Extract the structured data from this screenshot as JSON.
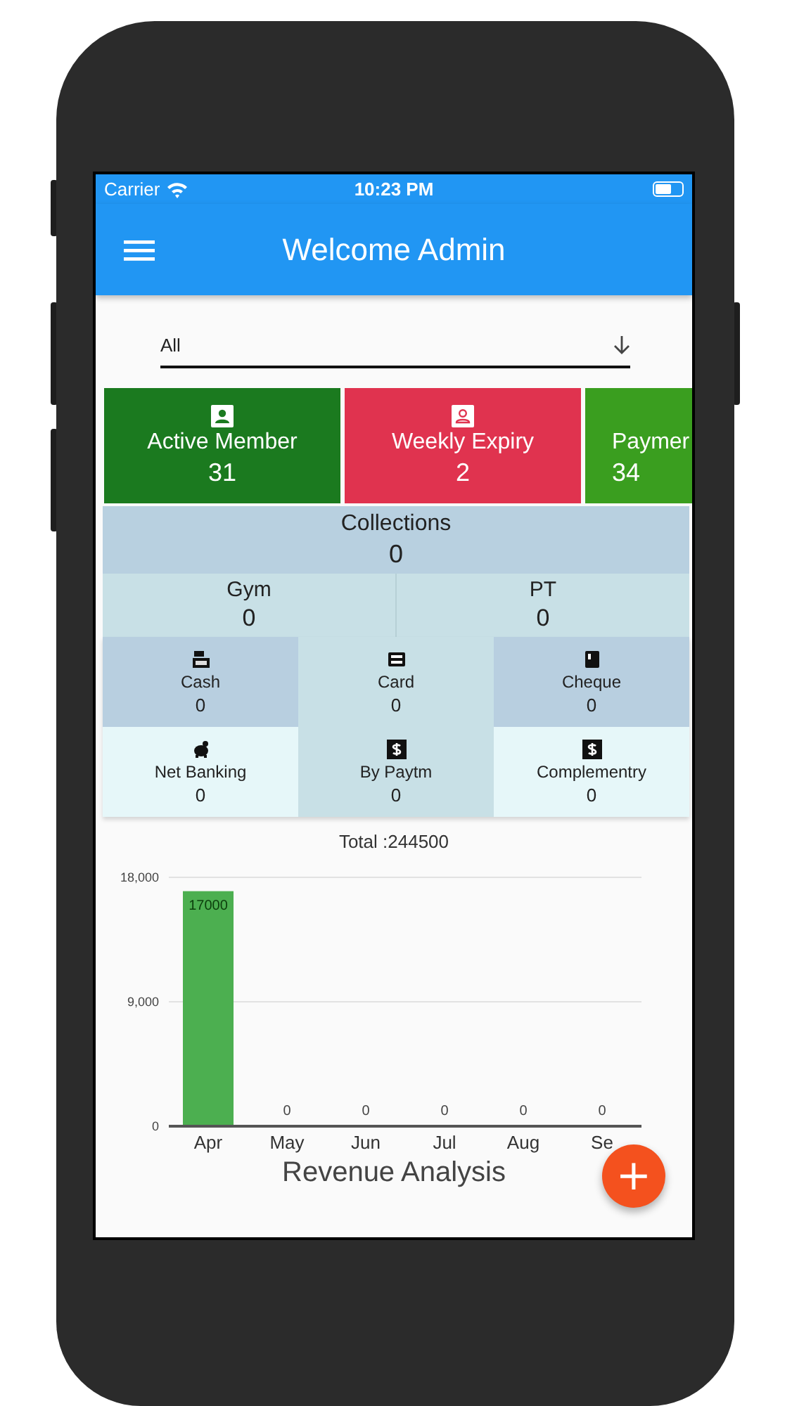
{
  "status_bar": {
    "carrier": "Carrier",
    "time": "10:23 PM"
  },
  "app_bar": {
    "title": "Welcome Admin"
  },
  "filter": {
    "value": "All"
  },
  "tiles": [
    {
      "label": "Active Member",
      "value": "31",
      "color": "#1b7a1f",
      "kind": "person"
    },
    {
      "label": "Weekly Expiry",
      "value": "2",
      "color": "#e0334f",
      "kind": "person-outline"
    },
    {
      "label": "Paymer",
      "value": "34",
      "color": "#3a9e1f",
      "kind": "cut"
    }
  ],
  "collections": {
    "label": "Collections",
    "value": "0"
  },
  "split": [
    {
      "label": "Gym",
      "value": "0"
    },
    {
      "label": "PT",
      "value": "0"
    }
  ],
  "modes": [
    {
      "label": "Cash",
      "value": "0",
      "kind": "register",
      "color": "#b8cfe0"
    },
    {
      "label": "Card",
      "value": "0",
      "kind": "card",
      "color": "#c8e0e6"
    },
    {
      "label": "Cheque",
      "value": "0",
      "kind": "cheque",
      "color": "#b8cfe0"
    },
    {
      "label": "Net Banking",
      "value": "0",
      "kind": "piggy",
      "color": "#e6f7f9"
    },
    {
      "label": "By Paytm",
      "value": "0",
      "kind": "dollar",
      "color": "#c8e0e6"
    },
    {
      "label": "Complementry",
      "value": "0",
      "kind": "dollar",
      "color": "#e6f7f9"
    }
  ],
  "total": "Total :244500",
  "revenue": {
    "chart_data": {
      "type": "bar",
      "title": "Revenue Analysis",
      "categories": [
        "Apr",
        "May",
        "Jun",
        "Jul",
        "Aug",
        "Se"
      ],
      "series": [
        {
          "color": "#4caf50",
          "values": [
            17000,
            0,
            0,
            0,
            0,
            0
          ]
        }
      ],
      "ylim": [
        0,
        18000
      ],
      "yticks": [
        {
          "value": 0,
          "label": "0"
        },
        {
          "value": 9000,
          "label": "9,000"
        },
        {
          "value": 18000,
          "label": "18,000"
        }
      ],
      "data_labels": true
    }
  },
  "fab": {
    "label": "+"
  }
}
